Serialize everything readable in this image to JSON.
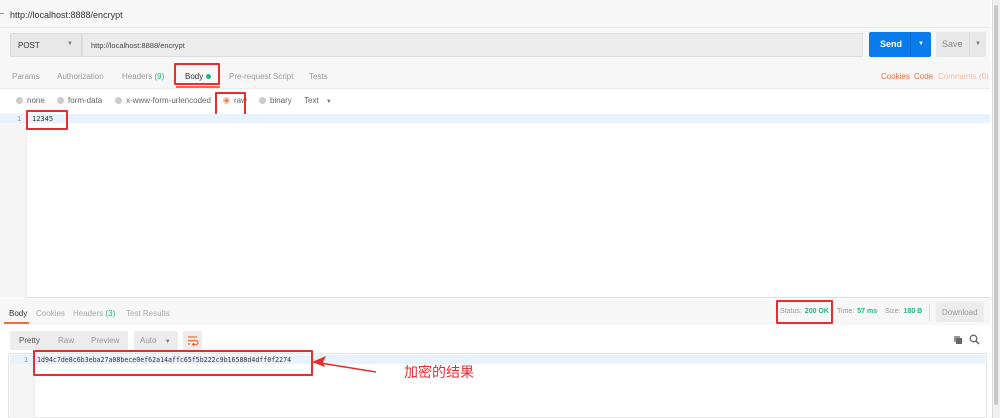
{
  "title": "http://localhost:8888/encrypt",
  "request": {
    "method": "POST",
    "url": "http://localhost:8888/encrypt",
    "send_label": "Send",
    "save_label": "Save"
  },
  "tabs": {
    "params": "Params",
    "authorization": "Authorization",
    "headers": "Headers",
    "headers_count": "(9)",
    "body": "Body",
    "prerequest": "Pre-request Script",
    "tests": "Tests"
  },
  "links": {
    "cookies": "Cookies",
    "code": "Code",
    "comments": "Comments (0)"
  },
  "body_types": {
    "none": "none",
    "form_data": "form-data",
    "urlencoded": "x-www-form-urlencoded",
    "raw": "raw",
    "binary": "binary",
    "format": "Text",
    "selected": "raw"
  },
  "editor": {
    "line_number": "1",
    "content": "12345"
  },
  "response": {
    "tabs": {
      "body": "Body",
      "cookies": "Cookies",
      "headers": "Headers",
      "headers_count": "(3)",
      "test_results": "Test Results"
    },
    "status_label": "Status:",
    "status": "200 OK",
    "time_label": "Time:",
    "time": "57 ms",
    "size_label": "Size:",
    "size": "180 B",
    "download": "Download",
    "views": {
      "pretty": "Pretty",
      "raw": "Raw",
      "preview": "Preview",
      "auto": "Auto"
    },
    "line_number": "1",
    "content": "1d94c7de8c6b3eba27a08bece0ef62a14affc65f5b222c9b16588d4dff0f2274"
  },
  "annotation": "加密的结果",
  "colors": {
    "accent": "#f26b3a",
    "send": "#097bed",
    "success": "#26b47f",
    "highlight": "#e62e2e"
  }
}
